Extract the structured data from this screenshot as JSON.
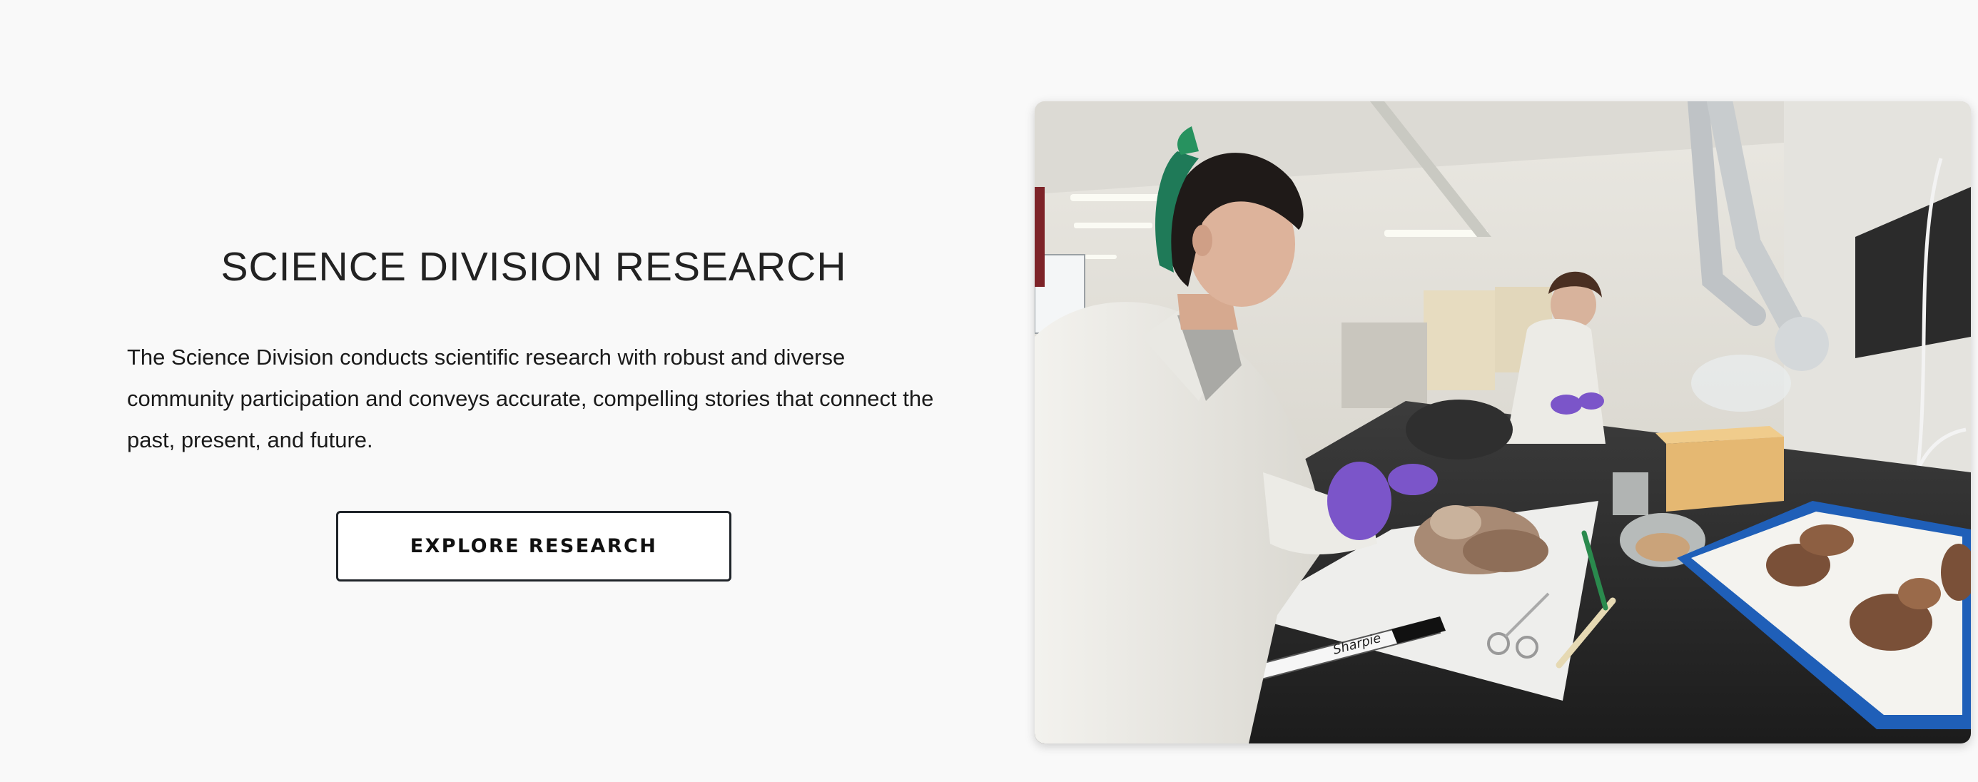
{
  "research": {
    "title": "SCIENCE DIVISION RESEARCH",
    "description": "The Science Division conducts scientific research with robust and diverse community participation and conveys accurate, compelling stories that connect the past, present, and future.",
    "button_label": "EXPLORE RESEARCH"
  },
  "photo": {
    "marker_brand": "Sharpie"
  },
  "colors": {
    "background": "#f9f9f9",
    "text": "#222222",
    "button_border": "#1f2429",
    "glove_purple": "#7b55c9",
    "tray_blue": "#1f5fb8"
  }
}
